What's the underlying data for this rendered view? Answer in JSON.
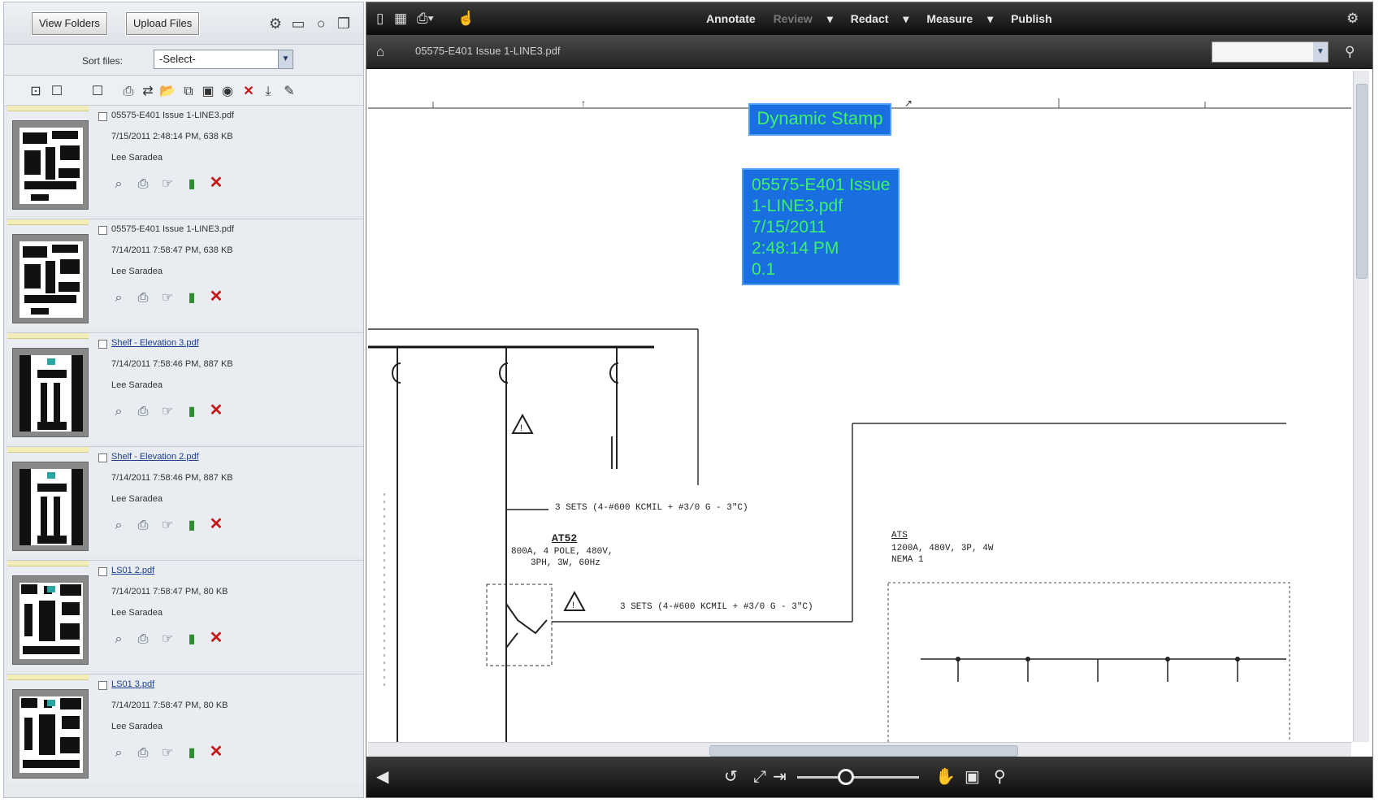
{
  "left_panel": {
    "view_folders_label": "View Folders",
    "upload_files_label": "Upload Files",
    "sort_label": "Sort files:",
    "sort_value": "-Select-",
    "cards": [
      {
        "name": "05575-E401 Issue 1-LINE3.pdf",
        "date": "7/15/2011 2:48:14 PM, 638 KB",
        "user": "Lee Saradea",
        "thumb": "plan"
      },
      {
        "name": "05575-E401 Issue 1-LINE3.pdf",
        "date": "7/14/2011 7:58:47 PM, 638 KB",
        "user": "Lee Saradea",
        "thumb": "plan"
      },
      {
        "name": "Shelf - Elevation 3.pdf",
        "date": "7/14/2011 7:58:46 PM, 887 KB",
        "user": "Lee Saradea",
        "thumb": "elev"
      },
      {
        "name": "Shelf - Elevation 2.pdf",
        "date": "7/14/2011 7:58:46 PM, 887 KB",
        "user": "Lee Saradea",
        "thumb": "elev"
      },
      {
        "name": "LS01 2.pdf",
        "date": "7/14/2011 7:58:47 PM, 80 KB",
        "user": "Lee Saradea",
        "thumb": "ls"
      },
      {
        "name": "LS01 3.pdf",
        "date": "7/14/2011 7:58:47 PM, 80 KB",
        "user": "Lee Saradea",
        "thumb": "ls"
      }
    ]
  },
  "viewer": {
    "menu": [
      "Annotate",
      "Review",
      "Redact",
      "Measure",
      "Publish"
    ],
    "doc_title": "05575-E401 Issue 1-LINE3.pdf",
    "stamp_title": "Dynamic Stamp",
    "stamp_lines": [
      "05575-E401 Issue",
      "1-LINE3.pdf",
      "7/15/2011",
      "2:48:14 PM",
      "0.1"
    ],
    "schematic": {
      "breaker_id": "AT52",
      "breaker_desc_1": "800A, 4 POLE, 480V,",
      "breaker_desc_2": "3PH, 3W, 60Hz",
      "feeder_1": "3 SETS (4-#600 KCMIL + #3/0 G - 3\"C)",
      "feeder_2": "3 SETS (4-#600 KCMIL + #3/0 G - 3\"C)",
      "panel_id": "ATS",
      "panel_desc_1": "1200A, 480V, 3P, 4W",
      "panel_desc_2": "NEMA 1"
    },
    "colors": {
      "stamp_bg": "#1a6fe0",
      "stamp_text": "#3ef06a",
      "toolbar": "#1a1a1a"
    }
  }
}
